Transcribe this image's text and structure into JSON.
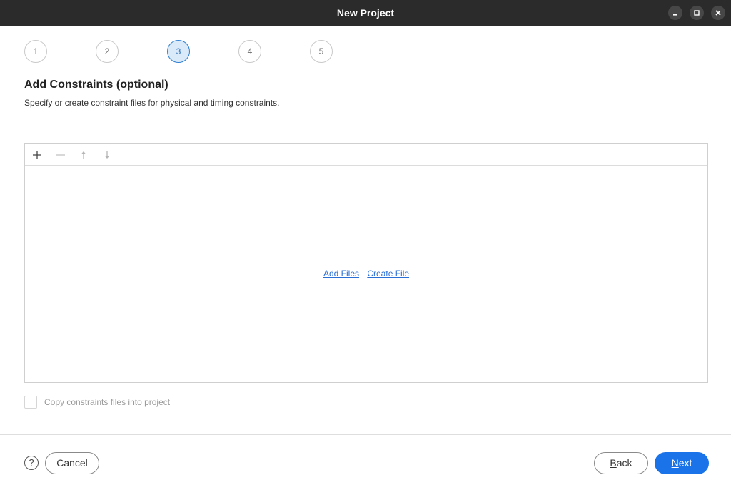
{
  "window": {
    "title": "New Project"
  },
  "steps": [
    {
      "label": "1",
      "active": false
    },
    {
      "label": "2",
      "active": false
    },
    {
      "label": "3",
      "active": true
    },
    {
      "label": "4",
      "active": false
    },
    {
      "label": "5",
      "active": false
    }
  ],
  "header": {
    "title": "Add Constraints (optional)",
    "description": "Specify or create constraint files for physical and timing constraints."
  },
  "file_panel": {
    "toolbar_icons": [
      "plus-icon",
      "minus-icon",
      "arrow-up-icon",
      "arrow-down-icon"
    ],
    "add_files_link": "Add Files",
    "create_file_link": "Create File"
  },
  "copy_option": {
    "label_pre": "Co",
    "label_mnemonic": "p",
    "label_post": "y constraints files into project",
    "checked": false
  },
  "footer": {
    "help_label": "?",
    "cancel_label": "Cancel",
    "back_mnemonic": "B",
    "back_rest": "ack",
    "next_mnemonic": "N",
    "next_rest": "ext"
  },
  "colors": {
    "accent": "#1a73e8",
    "link": "#2a6fd6",
    "titlebar": "#2b2b2b",
    "active_step_bg": "#dbeaf8"
  }
}
